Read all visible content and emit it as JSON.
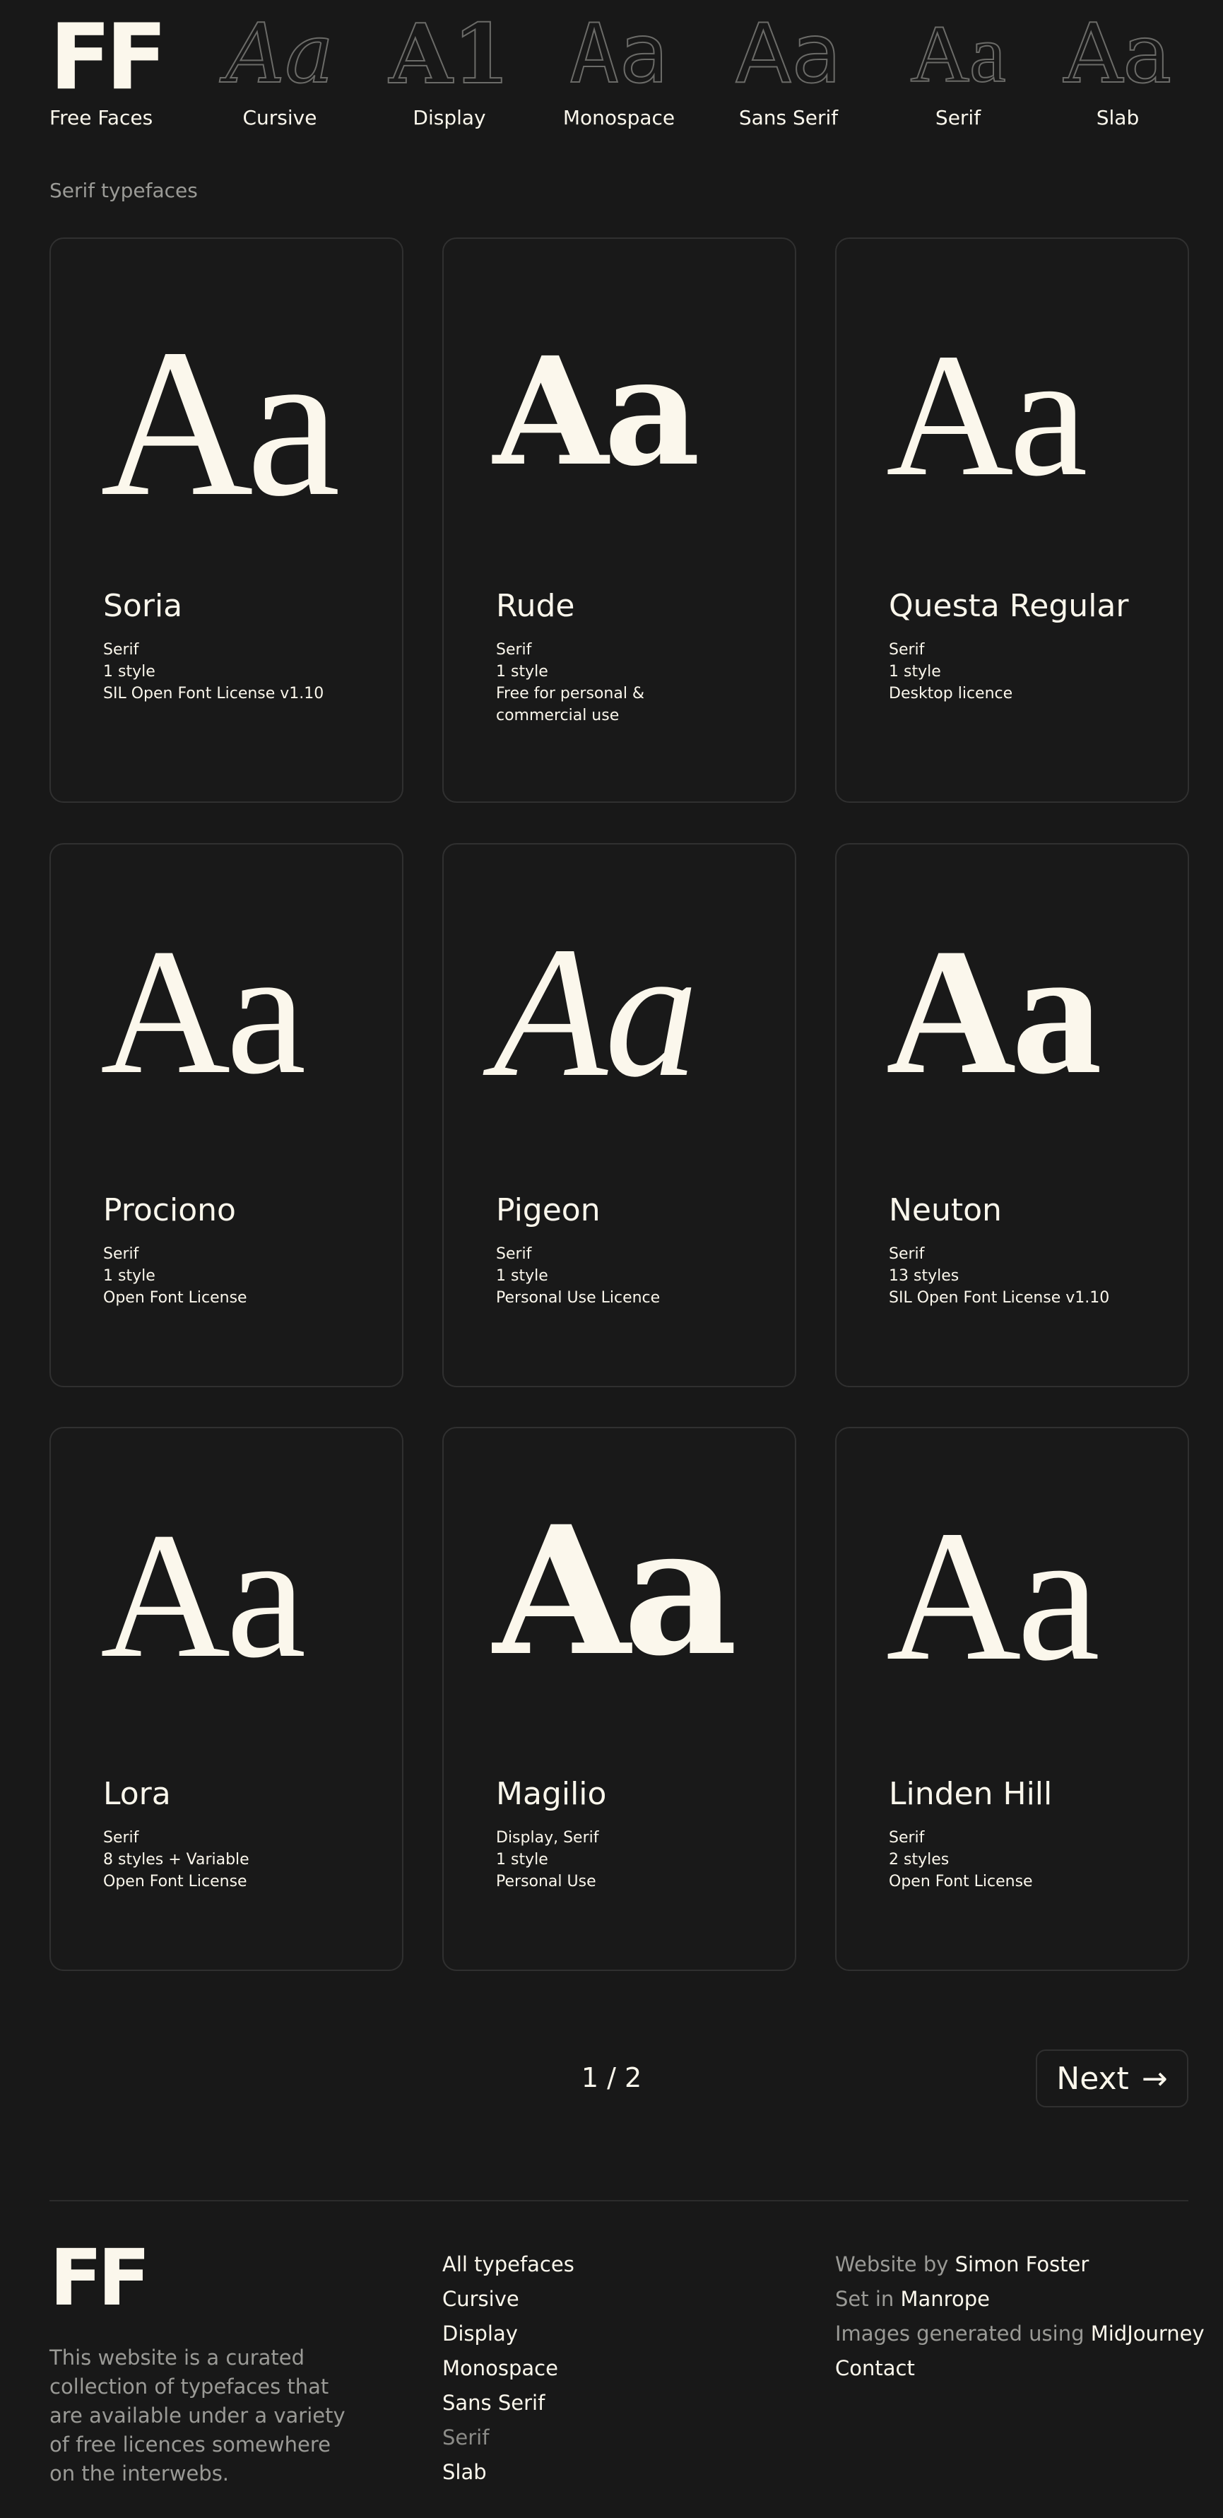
{
  "nav": {
    "logo": "FF",
    "home_label": "Free Faces",
    "categories": [
      {
        "glyph": "Aa",
        "label": "Cursive"
      },
      {
        "glyph": "A1",
        "label": "Display"
      },
      {
        "glyph": "Aa",
        "label": "Monospace"
      },
      {
        "glyph": "Aa",
        "label": "Sans Serif"
      },
      {
        "glyph": "Aa",
        "label": "Serif"
      },
      {
        "glyph": "Aa",
        "label": "Slab"
      }
    ]
  },
  "section_label": "Serif typefaces",
  "cards": [
    {
      "sample": "Aa",
      "name": "Soria",
      "category": "Serif",
      "styles": "1 style",
      "license": "SIL Open Font License v1.10"
    },
    {
      "sample": "Aa",
      "name": "Rude",
      "category": "Serif",
      "styles": "1 style",
      "license": "Free for personal & commercial use"
    },
    {
      "sample": "Aa",
      "name": "Questa Regular",
      "category": "Serif",
      "styles": "1 style",
      "license": "Desktop licence"
    },
    {
      "sample": "Aa",
      "name": "Prociono",
      "category": "Serif",
      "styles": "1 style",
      "license": "Open Font License"
    },
    {
      "sample": "Aa",
      "name": "Pigeon",
      "category": "Serif",
      "styles": "1 style",
      "license": "Personal Use Licence"
    },
    {
      "sample": "Aa",
      "name": "Neuton",
      "category": "Serif",
      "styles": "13 styles",
      "license": "SIL Open Font License v1.10"
    },
    {
      "sample": "Aa",
      "name": "Lora",
      "category": "Serif",
      "styles": "8 styles + Variable",
      "license": "Open Font License"
    },
    {
      "sample": "Aa",
      "name": "Magilio",
      "category": "Display, Serif",
      "styles": "1 style",
      "license": "Personal Use"
    },
    {
      "sample": "Aa",
      "name": "Linden Hill",
      "category": "Serif",
      "styles": "2 styles",
      "license": "Open Font License"
    }
  ],
  "pagination": {
    "page": "1 / 2",
    "next_label": "Next",
    "next_arrow": "→"
  },
  "footer": {
    "logo": "FF",
    "about": "This website is a curated collection of typefaces that are available under a variety of free licences somewhere on the interwebs.",
    "links": [
      "All typefaces",
      "Cursive",
      "Display",
      "Monospace",
      "Sans Serif",
      "Serif",
      "Slab"
    ],
    "credits": [
      {
        "prefix": "Website by ",
        "value": "Simon Foster"
      },
      {
        "prefix": "Set in ",
        "value": "Manrope"
      },
      {
        "prefix": "Images generated using ",
        "value": "MidJourney"
      },
      {
        "prefix": "",
        "value": "Contact"
      }
    ]
  },
  "colors": {
    "background": "#181818",
    "text": "#fbf7ec",
    "muted": "#9a9a96",
    "border": "#303030"
  }
}
